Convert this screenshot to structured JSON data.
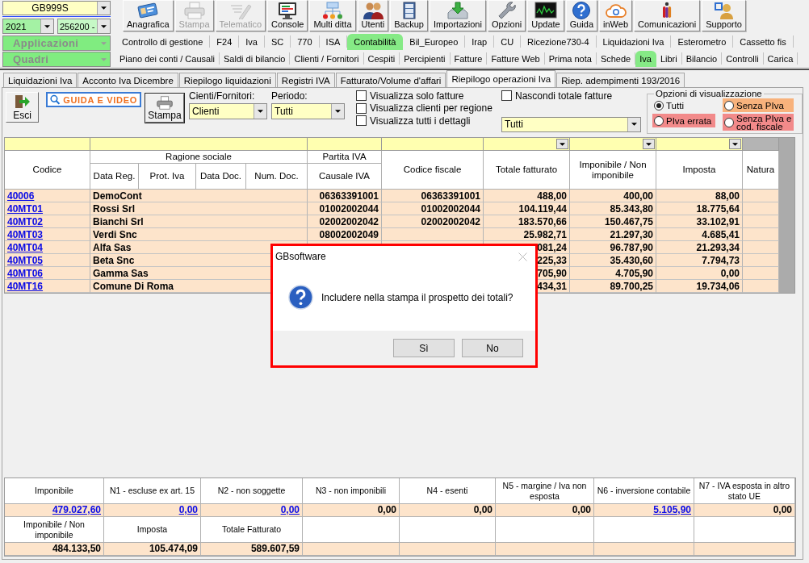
{
  "header": {
    "company": "GB999S",
    "year": "2021",
    "code": "256200 -",
    "applications": "Applicazioni",
    "sections": "Quadri"
  },
  "toolbar": [
    {
      "label": "Anagrafica",
      "disabled": false
    },
    {
      "label": "Stampa",
      "disabled": true
    },
    {
      "label": "Telematico",
      "disabled": true
    },
    {
      "label": "Console",
      "disabled": false
    },
    {
      "label": "Multi ditta",
      "disabled": false
    },
    {
      "label": "Utenti",
      "disabled": false
    },
    {
      "label": "Backup",
      "disabled": false
    },
    {
      "label": "Importazioni",
      "disabled": false
    },
    {
      "label": "Opzioni",
      "disabled": false
    },
    {
      "label": "Update",
      "disabled": false
    },
    {
      "label": "Guida",
      "disabled": false
    },
    {
      "label": "inWeb",
      "disabled": false
    },
    {
      "label": "Comunicazioni",
      "disabled": false
    },
    {
      "label": "Supporto",
      "disabled": false
    }
  ],
  "application_tabs": [
    {
      "label": "Controllo di gestione",
      "selected": false
    },
    {
      "label": "F24",
      "selected": false
    },
    {
      "label": "Iva",
      "selected": false
    },
    {
      "label": "SC",
      "selected": false
    },
    {
      "label": "770",
      "selected": false
    },
    {
      "label": "ISA",
      "selected": false
    },
    {
      "label": "Contabilità",
      "selected": true
    },
    {
      "label": "Bil_Europeo",
      "selected": false
    },
    {
      "label": "Irap",
      "selected": false
    },
    {
      "label": "CU",
      "selected": false
    },
    {
      "label": "Ricezione730-4",
      "selected": false
    },
    {
      "label": "Liquidazioni Iva",
      "selected": false
    },
    {
      "label": "Esterometro",
      "selected": false
    },
    {
      "label": "Cassetto fis",
      "selected": false
    }
  ],
  "section_tabs": [
    {
      "label": "Piano dei conti / Causali",
      "selected": false
    },
    {
      "label": "Saldi di bilancio",
      "selected": false
    },
    {
      "label": "Clienti / Fornitori",
      "selected": false
    },
    {
      "label": "Cespiti",
      "selected": false
    },
    {
      "label": "Percipienti",
      "selected": false
    },
    {
      "label": "Fatture",
      "selected": false
    },
    {
      "label": "Fatture Web",
      "selected": false
    },
    {
      "label": "Prima nota",
      "selected": false
    },
    {
      "label": "Schede",
      "selected": false
    },
    {
      "label": "Iva",
      "selected": true
    },
    {
      "label": "Libri",
      "selected": false
    },
    {
      "label": "Bilancio",
      "selected": false
    },
    {
      "label": "Controlli",
      "selected": false
    },
    {
      "label": "Carica",
      "selected": false
    }
  ],
  "form_tabs": [
    {
      "label": "Liquidazioni Iva",
      "selected": false
    },
    {
      "label": "Acconto Iva Dicembre",
      "selected": false
    },
    {
      "label": "Riepilogo liquidazioni",
      "selected": false
    },
    {
      "label": "Registri IVA",
      "selected": false
    },
    {
      "label": "Fatturato/Volume d'affari",
      "selected": false
    },
    {
      "label": "Riepilogo operazioni Iva",
      "selected": true
    },
    {
      "label": "Riep. adempimenti 193/2016",
      "selected": false
    }
  ],
  "form": {
    "exit_button": "Esci",
    "guide_button": "GUIDA E VIDEO",
    "print_button": "Stampa",
    "party_filter": {
      "label": "Cienti/Fornitori:",
      "value": "Clienti"
    },
    "period_filter": {
      "label": "Periodo:",
      "value": "Tutti"
    },
    "options": [
      {
        "label": "Visualizza solo fatture",
        "checked": false
      },
      {
        "label": "Visualizza clienti per regione",
        "checked": false
      },
      {
        "label": "Visualizza tutti i dettagli",
        "checked": false
      }
    ],
    "hide_totals": {
      "label": "Nascondi totale fatture",
      "checked": false
    },
    "invoice_filter": {
      "value": "Tutti"
    },
    "display_options": {
      "title": "Opzioni di visualizzazione",
      "choices": [
        {
          "label": "Tutti",
          "selected": true
        },
        {
          "label": "Senza PIva",
          "selected": false,
          "color": "#f8b27c"
        },
        {
          "label": "PIva errata",
          "selected": false,
          "color": "#f28a8a"
        },
        {
          "label": "Senza PIva e cod. fiscale",
          "selected": false,
          "color": "#f28a8a"
        }
      ]
    }
  },
  "table": {
    "columns": [
      {
        "label": "Codice",
        "kind": "link",
        "filter": true,
        "dropdown": false
      },
      {
        "label": "Ragione sociale",
        "sub_labels": [
          "Data Reg.",
          "Prot. Iva",
          "Data Doc.",
          "Num. Doc."
        ],
        "kind": "text",
        "filter": true,
        "dropdown": false
      },
      {
        "label": "Partita IVA",
        "sub_labels": [
          "Causale IVA"
        ],
        "kind": "number",
        "filter": true,
        "dropdown": false
      },
      {
        "label": "Codice fiscale",
        "kind": "number",
        "filter": true,
        "dropdown": false
      },
      {
        "label": "Totale fatturato",
        "kind": "number",
        "filter": true,
        "dropdown": true
      },
      {
        "label": "Imponibile / Non imponibile",
        "kind": "number",
        "filter": true,
        "dropdown": true
      },
      {
        "label": "Imposta",
        "kind": "number",
        "filter": true,
        "dropdown": true
      },
      {
        "label": "Natura",
        "kind": "text",
        "filter": false,
        "dropdown": false
      }
    ],
    "rows": [
      {
        "codice": "40006",
        "ragione_sociale": "DemoCont",
        "partita_iva": "06363391001",
        "codice_fiscale": "06363391001",
        "totale_fatturato": "488,00",
        "imponibile": "400,00",
        "imposta": "88,00"
      },
      {
        "codice": "40MT01",
        "ragione_sociale": "Rossi Srl",
        "partita_iva": "01002002044",
        "codice_fiscale": "01002002044",
        "totale_fatturato": "104.119,44",
        "imponibile": "85.343,80",
        "imposta": "18.775,64"
      },
      {
        "codice": "40MT02",
        "ragione_sociale": "Bianchi Srl",
        "partita_iva": "02002002042",
        "codice_fiscale": "02002002042",
        "totale_fatturato": "183.570,66",
        "imponibile": "150.467,75",
        "imposta": "33.102,91"
      },
      {
        "codice": "40MT03",
        "ragione_sociale": "Verdi Snc",
        "partita_iva": "08002002049",
        "totale_fatturato": "25.982,71",
        "imponibile": "21.297,30",
        "imposta": "4.685,41"
      },
      {
        "codice": "40MT04",
        "ragione_sociale": "Alfa Sas",
        "totale_fatturato": "081,24",
        "imponibile": "96.787,90",
        "imposta": "21.293,34"
      },
      {
        "codice": "40MT05",
        "ragione_sociale": "Beta Snc",
        "totale_fatturato": "225,33",
        "imponibile": "35.430,60",
        "imposta": "7.794,73"
      },
      {
        "codice": "40MT06",
        "ragione_sociale": "Gamma Sas",
        "totale_fatturato": "705,90",
        "imponibile": "4.705,90",
        "imposta": "0,00"
      },
      {
        "codice": "40MT16",
        "ragione_sociale": "Comune Di Roma",
        "totale_fatturato": "434,31",
        "imponibile": "89.700,25",
        "imposta": "19.734,06"
      }
    ]
  },
  "totals": {
    "rows": [
      {
        "headers": [
          "Imponibile",
          "N1 - escluse ex art. 15",
          "N2 - non soggette",
          "N3 - non imponibili",
          "N4 - esenti",
          "N5 - margine / Iva non esposta",
          "N6 - inversione contabile",
          "N7 - IVA esposta in altro stato UE"
        ],
        "values": [
          {
            "text": "479.027,60",
            "link": true
          },
          {
            "text": "0,00",
            "link": true
          },
          {
            "text": "0,00",
            "link": true
          },
          {
            "text": "0,00",
            "link": false
          },
          {
            "text": "0,00",
            "link": false
          },
          {
            "text": "0,00",
            "link": false
          },
          {
            "text": "5.105,90",
            "link": true
          },
          {
            "text": "0,00",
            "link": false
          }
        ]
      },
      {
        "headers": [
          "Imponibile / Non imponibile",
          "Imposta",
          "Totale Fatturato"
        ],
        "values": [
          {
            "text": "484.133,50",
            "link": false
          },
          {
            "text": "105.474,09",
            "link": false
          },
          {
            "text": "589.607,59",
            "link": false
          }
        ]
      }
    ]
  },
  "dialog": {
    "title": "GBsoftware",
    "message": "Includere nella stampa il prospetto dei totali?",
    "buttons": [
      "Sì",
      "No"
    ]
  }
}
